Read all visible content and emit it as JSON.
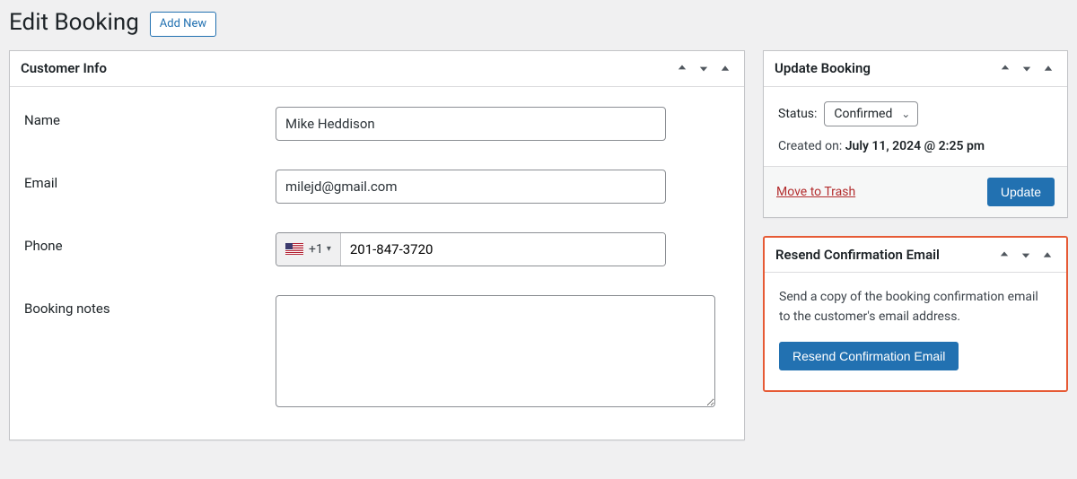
{
  "header": {
    "title": "Edit Booking",
    "add_new_label": "Add New"
  },
  "customer_info": {
    "panel_title": "Customer Info",
    "fields": {
      "name": {
        "label": "Name",
        "value": "Mike Heddison"
      },
      "email": {
        "label": "Email",
        "value": "milejd@gmail.com"
      },
      "phone": {
        "label": "Phone",
        "dial_code": "+1",
        "number": "201-847-3720"
      },
      "notes": {
        "label": "Booking notes",
        "value": ""
      }
    }
  },
  "update_booking": {
    "panel_title": "Update Booking",
    "status_label": "Status:",
    "status_value": "Confirmed",
    "created_label": "Created on:",
    "created_value": "July 11, 2024 @ 2:25 pm",
    "trash_label": "Move to Trash",
    "update_label": "Update"
  },
  "resend": {
    "panel_title": "Resend Confirmation Email",
    "description": "Send a copy of the booking confirmation email to the customer's email address.",
    "button_label": "Resend Confirmation Email"
  }
}
